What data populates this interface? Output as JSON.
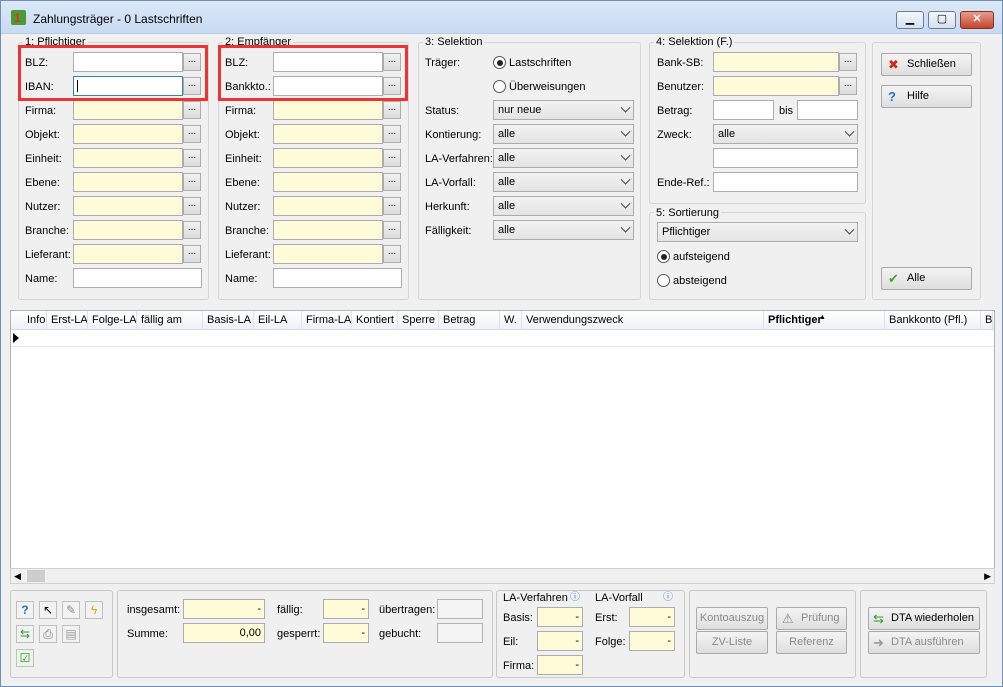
{
  "window": {
    "title": "Zahlungsträger - 0 Lastschriften",
    "min": "▁",
    "max": "▢",
    "close": "✕"
  },
  "g1": {
    "label": "1: Pflichtiger",
    "fields": [
      {
        "label": "BLZ:"
      },
      {
        "label": "IBAN:"
      },
      {
        "label": "Firma:"
      },
      {
        "label": "Objekt:"
      },
      {
        "label": "Einheit:"
      },
      {
        "label": "Ebene:"
      },
      {
        "label": "Nutzer:"
      },
      {
        "label": "Branche:"
      },
      {
        "label": "Lieferant:"
      },
      {
        "label": "Name:"
      }
    ]
  },
  "g2": {
    "label": "2: Empfänger",
    "fields": [
      {
        "label": "BLZ:"
      },
      {
        "label": "Bankkto.:"
      },
      {
        "label": "Firma:"
      },
      {
        "label": "Objekt:"
      },
      {
        "label": "Einheit:"
      },
      {
        "label": "Ebene:"
      },
      {
        "label": "Nutzer:"
      },
      {
        "label": "Branche:"
      },
      {
        "label": "Lieferant:"
      },
      {
        "label": "Name:"
      }
    ]
  },
  "dots": "...",
  "g3": {
    "label": "3: Selektion",
    "traeger": "Träger:",
    "radio1": "Lastschriften",
    "radio2": "Überweisungen",
    "rows": [
      {
        "label": "Status:",
        "value": "nur neue"
      },
      {
        "label": "Kontierung:",
        "value": "alle"
      },
      {
        "label": "LA-Verfahren:",
        "value": "alle"
      },
      {
        "label": "LA-Vorfall:",
        "value": "alle"
      },
      {
        "label": "Herkunft:",
        "value": "alle"
      },
      {
        "label": "Fälligkeit:",
        "value": "alle"
      }
    ]
  },
  "g4": {
    "label": "4: Selektion (F.)",
    "banksb": "Bank-SB:",
    "benutzer": "Benutzer:",
    "betrag": "Betrag:",
    "bis": "bis",
    "zweck": "Zweck:",
    "zweck_value": "alle",
    "enderef": "Ende-Ref.:"
  },
  "g5": {
    "label": "5: Sortierung",
    "value": "Pflichtiger",
    "asc": "aufsteigend",
    "desc": "absteigend"
  },
  "buttons": {
    "close": "Schließen",
    "help": "Hilfe",
    "all": "Alle"
  },
  "grid": {
    "columns": [
      "Info",
      "Erst-LA",
      "Folge-LA",
      "fällig am",
      "Basis-LA",
      "Eil-LA",
      "Firma-LA",
      "Kontiert",
      "Sperre",
      "Betrag",
      "W.",
      "Verwendungszweck",
      "Pflichtiger",
      "Bankkonto (Pfl.)",
      "BL"
    ]
  },
  "totals": {
    "insgesamt": "insgesamt:",
    "summe": "Summe:",
    "summe_value": "0,00",
    "faellig": "fällig:",
    "gesperrt": "gesperrt:",
    "uebertragen": "übertragen:",
    "gebucht": "gebucht:",
    "dash": "-"
  },
  "la": {
    "verfahren": "LA-Verfahren",
    "vorfall": "LA-Vorfall",
    "basis": "Basis:",
    "eil": "Eil:",
    "firma": "Firma:",
    "erst": "Erst:",
    "folge": "Folge:"
  },
  "actions": {
    "kontoauszug": "Kontoauszug",
    "pruefung": "Prüfung",
    "zvliste": "ZV-Liste",
    "referenz": "Referenz",
    "dta_repeat": "DTA wiederholen",
    "dta_exec": "DTA ausführen"
  }
}
